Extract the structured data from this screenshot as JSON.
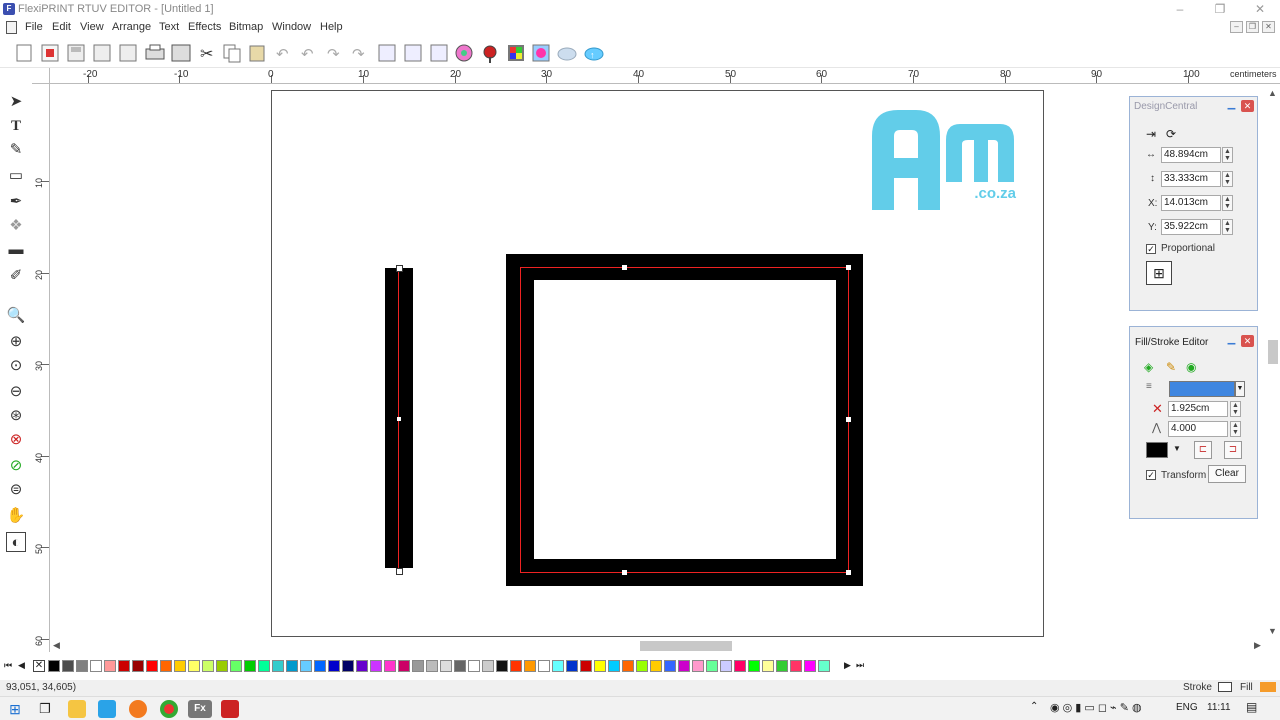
{
  "window": {
    "title": "FlexiPRINT RTUV EDITOR - [Untitled 1]",
    "controls": [
      "–",
      "❐",
      "✕"
    ]
  },
  "menu": [
    "File",
    "Edit",
    "View",
    "Arrange",
    "Text",
    "Effects",
    "Bitmap",
    "Window",
    "Help"
  ],
  "ruler": {
    "unit": "centimeters",
    "h_labels": [
      "-20",
      "-10",
      "0",
      "10",
      "20",
      "30",
      "40",
      "50",
      "60",
      "70",
      "80",
      "90",
      "100"
    ],
    "v_labels": [
      "10",
      "20",
      "30",
      "40",
      "50",
      "60"
    ]
  },
  "logo": {
    "letters": "Am",
    "sub": ".co.za",
    "color": "#62cde9"
  },
  "design_central": {
    "title": "DesignCentral",
    "width": "48.894cm",
    "height": "33.333cm",
    "x_label": "X:",
    "x": "14.013cm",
    "y_label": "Y:",
    "y": "35.922cm",
    "proportional": "Proportional",
    "proportional_checked": "✓"
  },
  "fill_stroke": {
    "title": "Fill/Stroke Editor",
    "stroke_width": "1.925cm",
    "miter": "4.000",
    "transform": "Transform",
    "transform_checked": "✓",
    "clear": "Clear",
    "stroke_color": "#000000"
  },
  "status": {
    "coords": "93,051,    34,605)",
    "stroke": "Stroke",
    "fill": "Fill"
  },
  "taskbar": {
    "lang": "ENG",
    "time": "11:11"
  },
  "palette_colors": [
    "#000000",
    "#4d4d4d",
    "#808080",
    "#ffffff",
    "#ff9999",
    "#cc0000",
    "#990000",
    "#ff0000",
    "#ff6600",
    "#ffcc00",
    "#ffff66",
    "#ccff66",
    "#99cc00",
    "#66ff66",
    "#00cc00",
    "#00ff99",
    "#33cccc",
    "#0099cc",
    "#66ccff",
    "#0066ff",
    "#0000cc",
    "#000066",
    "#6600cc",
    "#cc33ff",
    "#ff33cc",
    "#cc0066",
    "#999999",
    "#bbbbbb",
    "#dddddd",
    "#666666",
    "#ffffff",
    "#cccccc",
    "#111111",
    "#ff3300",
    "#ff9900",
    "#ffffff",
    "#66ffff",
    "#0033cc",
    "#cc0000",
    "#ffff00",
    "#00ccff",
    "#ff6600",
    "#99ff00",
    "#ffcc00",
    "#3366ff",
    "#cc00cc",
    "#ff99cc",
    "#66ff99",
    "#ccccff",
    "#ff0066",
    "#00ff00",
    "#ffff99",
    "#33cc33",
    "#ff3366",
    "#ff00ff",
    "#66ffcc"
  ]
}
